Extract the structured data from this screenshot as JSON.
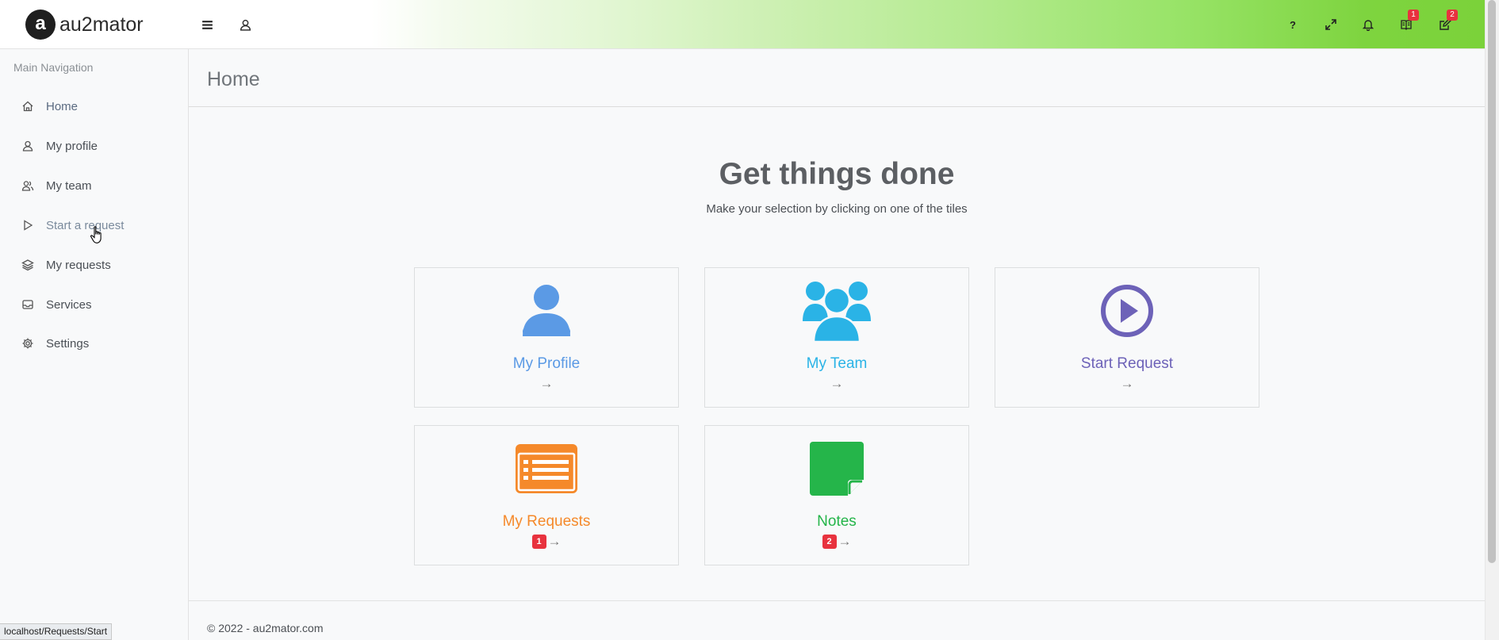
{
  "header": {
    "brand_letter": "a",
    "brand_name": "au2mator",
    "help_label": "?",
    "badges": {
      "tasks": "1",
      "notes": "2"
    }
  },
  "sidebar": {
    "title": "Main Navigation",
    "items": [
      {
        "label": "Home",
        "icon": "home-icon"
      },
      {
        "label": "My profile",
        "icon": "user-icon"
      },
      {
        "label": "My team",
        "icon": "team-icon"
      },
      {
        "label": "Start a request",
        "icon": "play-icon"
      },
      {
        "label": "My requests",
        "icon": "layers-icon"
      },
      {
        "label": "Services",
        "icon": "inbox-icon"
      },
      {
        "label": "Settings",
        "icon": "gear-icon"
      }
    ]
  },
  "main": {
    "page_title": "Home",
    "hero_title": "Get things done",
    "hero_subtitle": "Make your selection by clicking on one of the tiles",
    "tiles": [
      {
        "label": "My Profile",
        "icon": "user-icon",
        "color": "#5b9ae5",
        "arrow": "→"
      },
      {
        "label": "My Team",
        "icon": "team-icon",
        "color": "#2ab3e6",
        "arrow": "→"
      },
      {
        "label": "Start Request",
        "icon": "play-circle-icon",
        "color": "#6d62b8",
        "arrow": "→"
      },
      {
        "label": "My Requests",
        "icon": "list-card-icon",
        "color": "#f5892a",
        "arrow": "→",
        "badge": "1"
      },
      {
        "label": "Notes",
        "icon": "note-icon",
        "color": "#25b54a",
        "arrow": "→",
        "badge": "2"
      }
    ],
    "footer": "© 2022 - au2mator.com"
  },
  "status_bar": {
    "url": "localhost/Requests/Start"
  }
}
